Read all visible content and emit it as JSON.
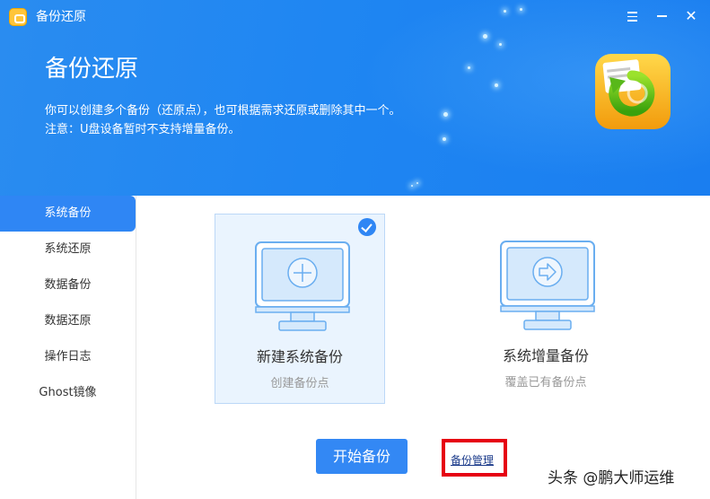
{
  "window": {
    "title": "备份还原",
    "menu_icon": "menu-icon",
    "minimize_icon": "minimize-icon",
    "close_icon": "close-icon",
    "close_glyph": "✕"
  },
  "hero": {
    "title": "备份还原",
    "description": "你可以创建多个备份（还原点），也可根据需求还原或删除其中一个。",
    "note": "注意：U盘设备暂时不支持增量备份。",
    "illustration_icon": "restore-backup-icon"
  },
  "sidebar": {
    "items": [
      {
        "label": "系统备份",
        "active": true
      },
      {
        "label": "系统还原",
        "active": false
      },
      {
        "label": "数据备份",
        "active": false
      },
      {
        "label": "数据还原",
        "active": false
      },
      {
        "label": "操作日志",
        "active": false
      },
      {
        "label": "Ghost镜像",
        "active": false
      }
    ]
  },
  "options": [
    {
      "title": "新建系统备份",
      "subtitle": "创建备份点",
      "icon": "monitor-plus-icon",
      "selected": true
    },
    {
      "title": "系统增量备份",
      "subtitle": "覆盖已有备份点",
      "icon": "monitor-arrow-icon",
      "selected": false
    }
  ],
  "actions": {
    "start_label": "开始备份",
    "manage_label": "备份管理"
  },
  "watermark": "头条 @鹏大师运维",
  "colors": {
    "accent": "#2f86f4",
    "header": "#1f86f2",
    "highlight_border": "#e60012"
  }
}
